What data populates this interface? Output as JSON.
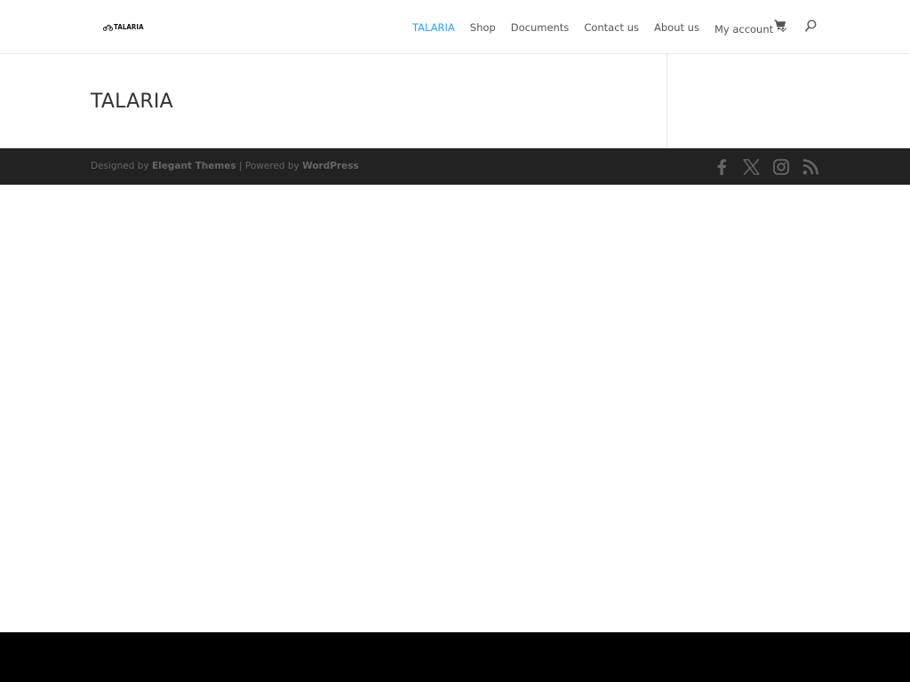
{
  "header": {
    "logo_text": "TALARIA",
    "nav": [
      {
        "label": "TALARIA",
        "active": true
      },
      {
        "label": "Shop",
        "active": false
      },
      {
        "label": "Documents",
        "active": false
      },
      {
        "label": "Contact us",
        "active": false
      },
      {
        "label": "About us",
        "active": false
      },
      {
        "label": "My account",
        "active": false,
        "has_dropdown": true
      }
    ],
    "cart_icon": "cart-icon",
    "search_icon": "search-icon"
  },
  "main": {
    "page_title": "TALARIA"
  },
  "footer": {
    "designed_by_prefix": "Designed by",
    "designed_by_link": "Elegant Themes",
    "separator": "|",
    "powered_by_prefix": "Powered by",
    "powered_by_link": "WordPress",
    "social_icons": [
      "facebook-icon",
      "x-icon",
      "instagram-icon",
      "rss-icon"
    ]
  },
  "colors": {
    "accent": "#2ea3f2",
    "nav_text": "#555555",
    "footer_bg": "#222222",
    "footer_text": "#666666"
  }
}
